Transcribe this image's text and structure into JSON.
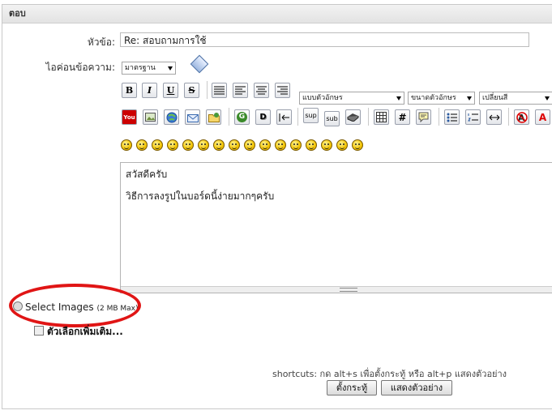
{
  "panel": {
    "title": "ตอบ"
  },
  "form": {
    "subject_label": "หัวข้อ:",
    "subject_value": "Re: สอบถามการใช้",
    "icon_label": "ไอค่อนข้อความ:",
    "icon_select": "มาตรฐาน"
  },
  "toolbar": {
    "bold": "B",
    "italic": "I",
    "underline": "U",
    "strike": "S",
    "font_select": "แบบตัวอักษร",
    "size_select": "ขนาดตัวอักษร",
    "color_select": "เปลี่ยนสี",
    "youtube": "You",
    "sup": "sup",
    "sub": "sub",
    "hash": "#",
    "glow": "G",
    "shadow": "D",
    "color_a": "A"
  },
  "editor": {
    "line1": "สวัสดีครับ",
    "line2": "วิธีการลงรูปในบอร์ดนี้ง่ายมากๆครับ"
  },
  "attachments": {
    "select_images": "Select Images",
    "max_size": "(2 MB Max)",
    "more_options": "ตัวเลือกเพิ่มเติม..."
  },
  "footer": {
    "shortcuts": "shortcuts: กด alt+s เพื่อตั้งกระทู้ หรือ alt+p แสดงตัวอย่าง",
    "post_button": "ตั้งกระทู้",
    "preview_button": "แสดงตัวอย่าง"
  },
  "colors": {
    "annotation_ellipse": "#e01515"
  }
}
